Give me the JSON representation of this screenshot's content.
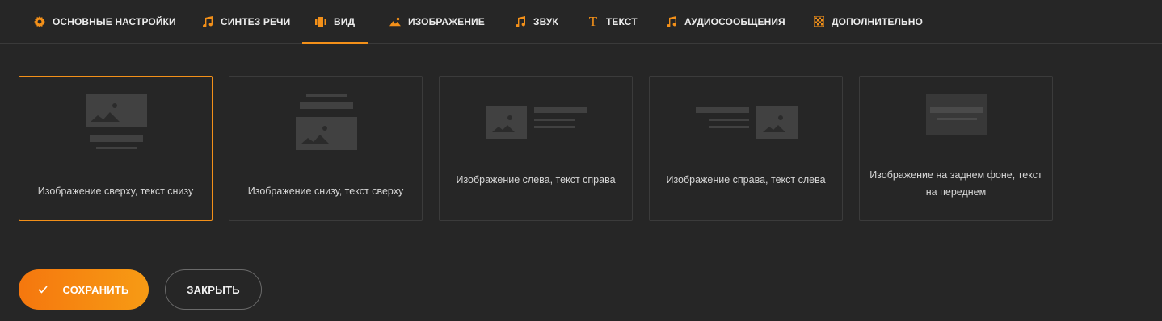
{
  "tabs": [
    {
      "label": "ОСНОВНЫЕ НАСТРОЙКИ",
      "icon": "gear-icon"
    },
    {
      "label": "СИНТЕЗ РЕЧИ",
      "icon": "music-note-icon"
    },
    {
      "label": "ВИД",
      "icon": "layout-icon",
      "active": true
    },
    {
      "label": "ИЗОБРАЖЕНИЕ",
      "icon": "image-icon"
    },
    {
      "label": "ЗВУК",
      "icon": "music-note-icon"
    },
    {
      "label": "ТЕКСТ",
      "icon": "text-icon"
    },
    {
      "label": "АУДИОСООБЩЕНИЯ",
      "icon": "music-note-icon"
    },
    {
      "label": "ДОПОЛНИТЕЛЬНО",
      "icon": "grid-icon"
    }
  ],
  "layouts": [
    {
      "label": "Изображение сверху, текст снизу",
      "selected": true
    },
    {
      "label": "Изображение снизу, текст сверху"
    },
    {
      "label": "Изображение слева, текст справа"
    },
    {
      "label": "Изображение справа, текст слева"
    },
    {
      "label": "Изображение на заднем фоне, текст на переднем"
    }
  ],
  "actions": {
    "save_label": "СОХРАНИТЬ",
    "close_label": "ЗАКРЫТЬ"
  },
  "colors": {
    "accent": "#f39019",
    "background": "#262626",
    "placeholder": "#414141"
  }
}
